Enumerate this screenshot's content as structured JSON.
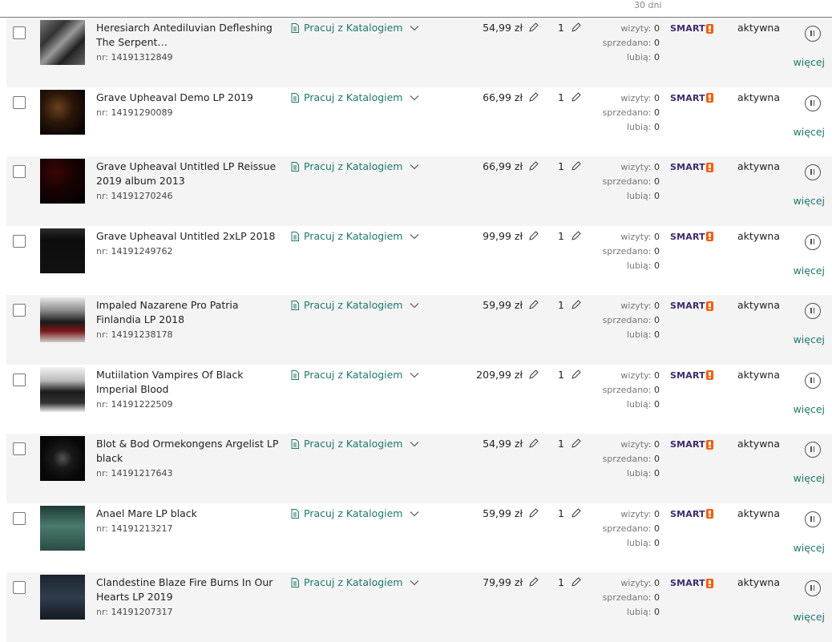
{
  "header": {
    "period_label": "30 dni"
  },
  "labels": {
    "catalog": "Pracuj z Katalogiem",
    "nr_prefix": "nr: ",
    "visits": "wizyty:",
    "sold": "sprzedano:",
    "liked": "lubią:",
    "smart": "SMART",
    "more": "więcej"
  },
  "colors": {
    "accent": "#1b7a6c",
    "smart": "#3c2b6e",
    "smart_badge": "#ff5a00",
    "alt_row": "#f4f4f4"
  },
  "rows": [
    {
      "title": "Heresiarch Antediluvian Defleshing The Serpent…",
      "nr": "14191312849",
      "price": "54,99 zł",
      "qty": "1",
      "visits": "0",
      "sold": "0",
      "liked": "0",
      "status": "aktywna",
      "thumb": "gray-collage"
    },
    {
      "title": "Grave Upheaval Demo LP 2019",
      "nr": "14191290089",
      "price": "66,99 zł",
      "qty": "1",
      "visits": "0",
      "sold": "0",
      "liked": "0",
      "status": "aktywna",
      "thumb": "dark-brown"
    },
    {
      "title": "Grave Upheaval Untitled LP Reissue 2019 album 2013",
      "nr": "14191270246",
      "price": "66,99 zł",
      "qty": "1",
      "visits": "0",
      "sold": "0",
      "liked": "0",
      "status": "aktywna",
      "thumb": "dark-red"
    },
    {
      "title": "Grave Upheaval Untitled 2xLP 2018",
      "nr": "14191249762",
      "price": "99,99 zł",
      "qty": "1",
      "visits": "0",
      "sold": "0",
      "liked": "0",
      "status": "aktywna",
      "thumb": "black-logo"
    },
    {
      "title": "Impaled Nazarene Pro Patria Finlandia LP 2018",
      "nr": "14191238178",
      "price": "59,99 zł",
      "qty": "1",
      "visits": "0",
      "sold": "0",
      "liked": "0",
      "status": "aktywna",
      "thumb": "white-red"
    },
    {
      "title": "Mutiilation Vampires Of Black Imperial Blood",
      "nr": "14191222509",
      "price": "209,99 zł",
      "qty": "1",
      "visits": "0",
      "sold": "0",
      "liked": "0",
      "status": "aktywna",
      "thumb": "white-bw"
    },
    {
      "title": "Blot & Bod Ormekongens Argelist LP black",
      "nr": "14191217643",
      "price": "54,99 zł",
      "qty": "1",
      "visits": "0",
      "sold": "0",
      "liked": "0",
      "status": "aktywna",
      "thumb": "black-triangle"
    },
    {
      "title": "Anael Mare LP black",
      "nr": "14191213217",
      "price": "59,99 zł",
      "qty": "1",
      "visits": "0",
      "sold": "0",
      "liked": "0",
      "status": "aktywna",
      "thumb": "teal-green"
    },
    {
      "title": "Clandestine Blaze Fire Burns In Our Hearts LP 2019",
      "nr": "14191207317",
      "price": "79,99 zł",
      "qty": "1",
      "visits": "0",
      "sold": "0",
      "liked": "0",
      "status": "aktywna",
      "thumb": "dark-blue-text"
    }
  ]
}
